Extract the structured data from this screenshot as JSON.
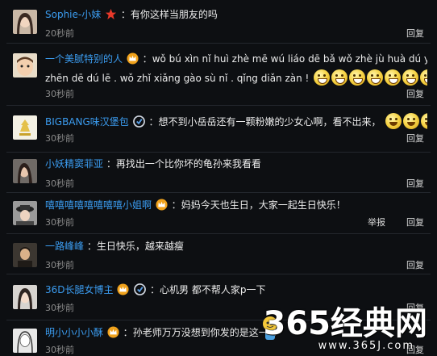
{
  "comments": [
    {
      "avatar": "female-avatar",
      "username": "Sophie-小妹",
      "badges": [
        "star-badge"
      ],
      "text": "有你这样当朋友的吗",
      "emojis": 0,
      "time": "20秒前",
      "actions": [
        "回复"
      ]
    },
    {
      "avatar": "child-avatar",
      "username": "一个美腻特别的人",
      "badges": [
        "vip-crown-badge"
      ],
      "text": "wǒ bú xìn nǐ huì zhè mē wú liáo dē bǎ wǒ zhè jù huà dú yí biàn . rú",
      "text2": "zhēn dē dú lē . wǒ zhǐ xiǎng gào sù nǐ . qǐng diǎn zàn !",
      "emojis": 8,
      "emoji_style": "grin",
      "time": "30秒前",
      "actions": [
        "回复"
      ]
    },
    {
      "avatar": "bigbang-avatar",
      "username": "BIGBANG味汉堡包",
      "badges": [
        "talent-badge"
      ],
      "text": "想不到小岳岳还有一颗粉嫩的少女心啊，看不出来，",
      "emojis": 3,
      "emoji_style": "smile",
      "time": "30秒前",
      "actions": [
        "回复"
      ]
    },
    {
      "avatar": "woman-avatar",
      "username": "小妖精窦菲亚",
      "badges": [],
      "text": "再找出一个比你坏的龟孙来我看看",
      "emojis": 0,
      "time": "30秒前",
      "actions": [
        "回复"
      ]
    },
    {
      "avatar": "hat-avatar",
      "username": "嘻嘻嘻嘻嘻嘻嘻嘻小姐啊",
      "badges": [
        "vip-crown-badge"
      ],
      "text": "妈妈今天也生日，大家一起生日快乐！",
      "emojis": 0,
      "time": "30秒前",
      "actions": [
        "举报",
        "回复"
      ]
    },
    {
      "avatar": "man-avatar",
      "username": "一路峰峰",
      "badges": [],
      "text": "生日快乐，越来越瘦",
      "emojis": 0,
      "time": "30秒前",
      "actions": [
        "回复"
      ]
    },
    {
      "avatar": "girl-avatar",
      "username": "36D长腿女博主",
      "badges": [
        "vip-crown-badge",
        "talent-badge"
      ],
      "text": "心机男 都不帮人家p一下",
      "emojis": 0,
      "time": "30秒前",
      "actions": [
        "回复"
      ]
    },
    {
      "avatar": "sketch-avatar",
      "username": "明小小小小酥",
      "badges": [
        "vip-crown-badge"
      ],
      "text": "孙老师万万没想到你发的是这一条",
      "emojis": 0,
      "time": "30秒前",
      "actions": [
        "回复"
      ]
    }
  ],
  "watermark": {
    "big": "365经典网",
    "small": "www.365J.com"
  },
  "colors": {
    "username": "#3b9cf0",
    "background": "#0d0f12",
    "time": "#8c8c8c"
  }
}
